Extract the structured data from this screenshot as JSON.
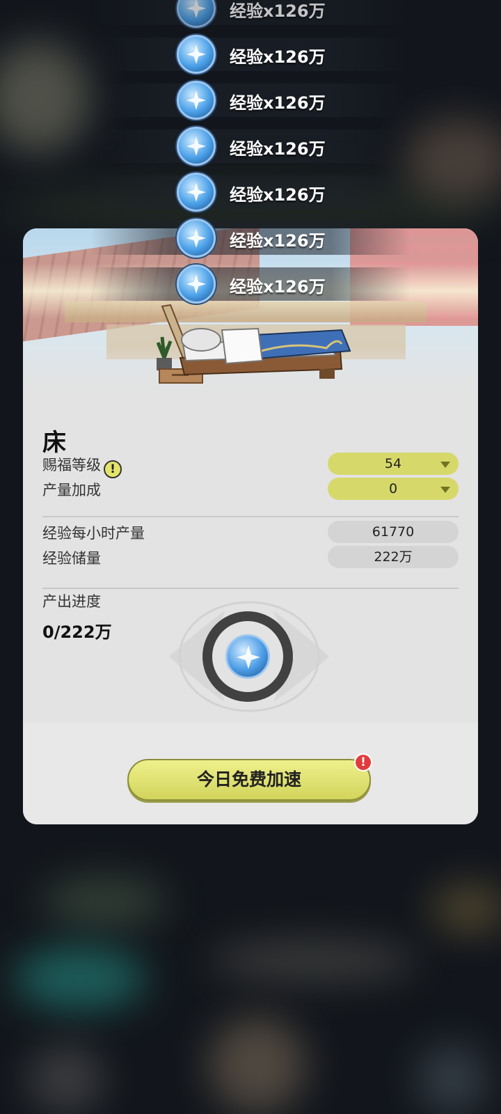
{
  "rewards": [
    {
      "text": "经验x126万",
      "icon": "exp-orb-icon"
    },
    {
      "text": "经验x126万",
      "icon": "exp-orb-icon"
    },
    {
      "text": "经验x126万",
      "icon": "exp-orb-icon"
    },
    {
      "text": "经验x126万",
      "icon": "exp-orb-icon"
    },
    {
      "text": "经验x126万",
      "icon": "exp-orb-icon"
    },
    {
      "text": "经验x126万",
      "icon": "exp-orb-icon"
    },
    {
      "text": "经验x126万",
      "icon": "exp-orb-icon"
    }
  ],
  "building": {
    "name": "床"
  },
  "settings": {
    "blessing_level_label": "赐福等级",
    "blessing_level_value": "54",
    "output_bonus_label": "产量加成",
    "output_bonus_value": "0",
    "info_icon_glyph": "!"
  },
  "stats": {
    "exp_per_hour_label": "经验每小时产量",
    "exp_per_hour_value": "61770",
    "exp_storage_label": "经验储量",
    "exp_storage_value": "222万"
  },
  "progress": {
    "label": "产出进度",
    "value": "0/222万"
  },
  "action": {
    "free_speedup_label": "今日免费加速",
    "alert_glyph": "!"
  },
  "colors": {
    "accent_yellow": "#d6d86a",
    "alert_red": "#e23b3b",
    "card_bg": "#e3e3e3"
  }
}
